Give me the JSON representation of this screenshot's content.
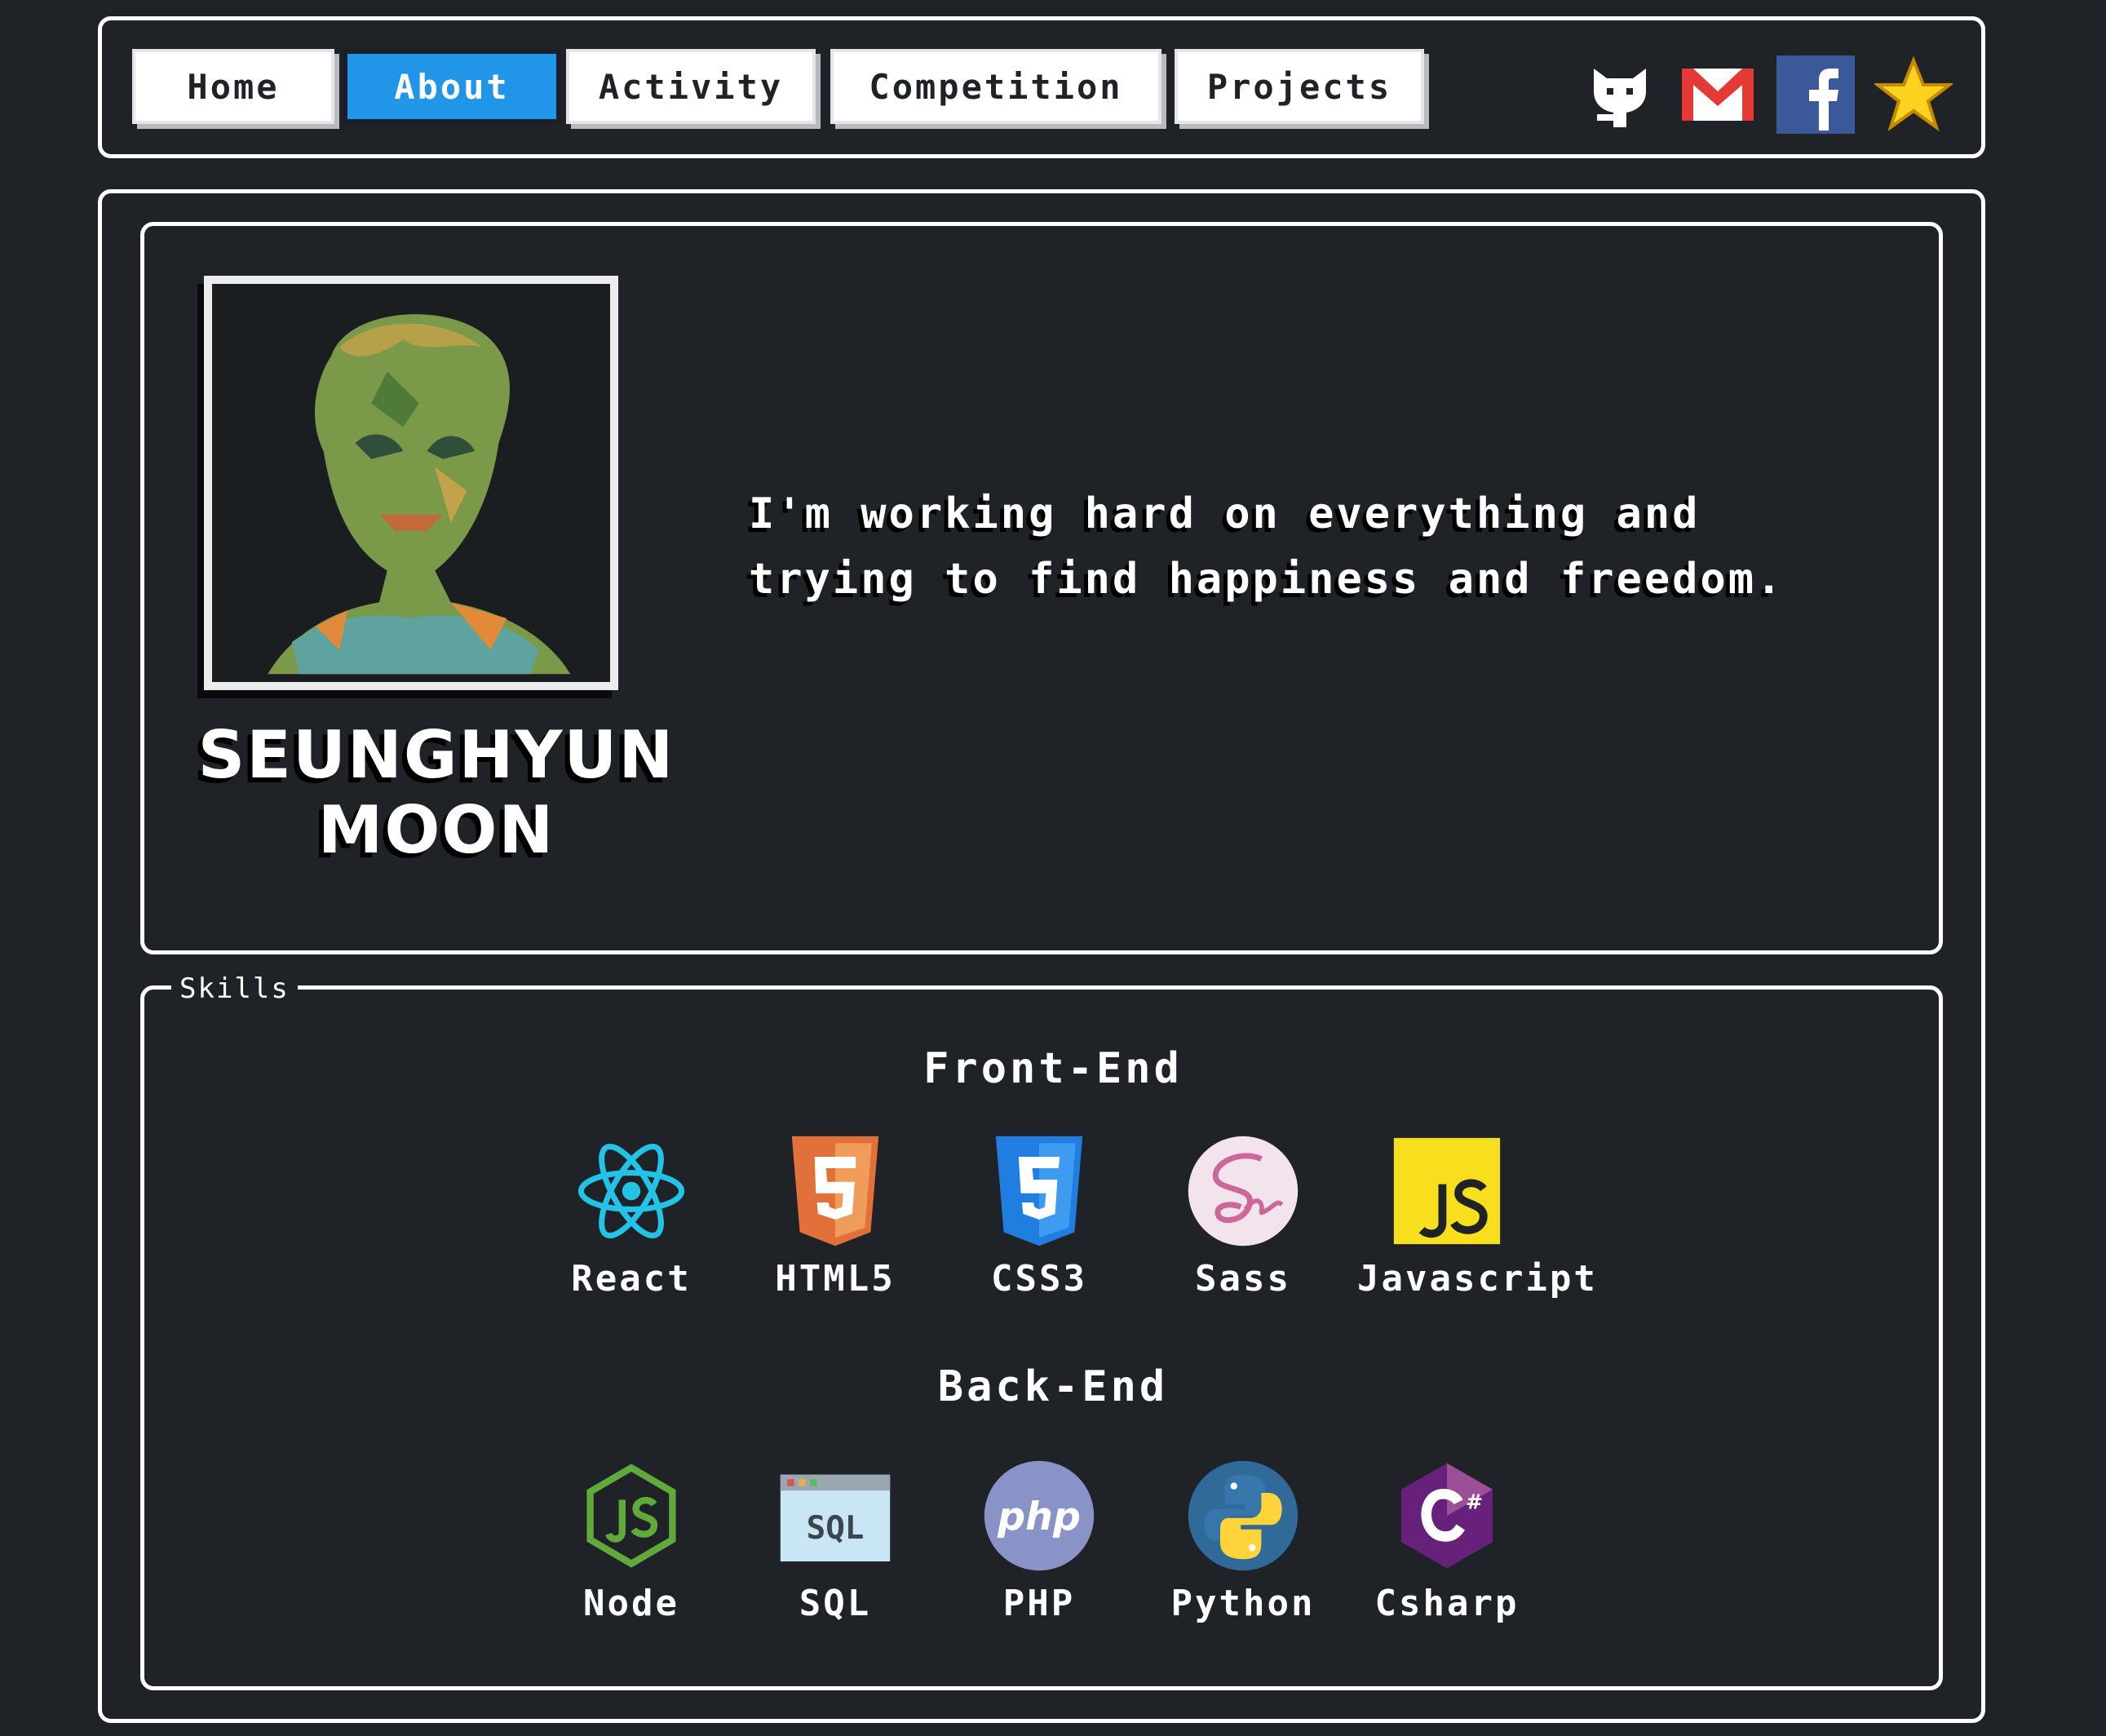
{
  "nav": {
    "items": [
      {
        "label": "Home"
      },
      {
        "label": "About",
        "active": true
      },
      {
        "label": "Activity"
      },
      {
        "label": "Competition"
      },
      {
        "label": "Projects"
      }
    ],
    "socials": [
      "github-icon",
      "gmail-icon",
      "facebook-icon",
      "star-icon"
    ]
  },
  "profile": {
    "name_line1": "SEUNGHYUN",
    "name_line2": "MOON",
    "bio": "I'm working hard on everything and trying to find happiness and freedom."
  },
  "skills": {
    "legend": "Skills",
    "frontend": {
      "title": "Front-End",
      "items": [
        {
          "label": "React",
          "icon": "react-icon"
        },
        {
          "label": "HTML5",
          "icon": "html5-icon"
        },
        {
          "label": "CSS3",
          "icon": "css3-icon"
        },
        {
          "label": "Sass",
          "icon": "sass-icon"
        },
        {
          "label": "Javascript",
          "icon": "javascript-icon"
        }
      ]
    },
    "backend": {
      "title": "Back-End",
      "items": [
        {
          "label": "Node",
          "icon": "nodejs-icon"
        },
        {
          "label": "SQL",
          "icon": "sql-icon"
        },
        {
          "label": "PHP",
          "icon": "php-icon"
        },
        {
          "label": "Python",
          "icon": "python-icon"
        },
        {
          "label": "Csharp",
          "icon": "csharp-icon"
        }
      ]
    }
  },
  "colors": {
    "background": "#1f2227",
    "accent": "#2196e8",
    "border": "#ffffff"
  }
}
